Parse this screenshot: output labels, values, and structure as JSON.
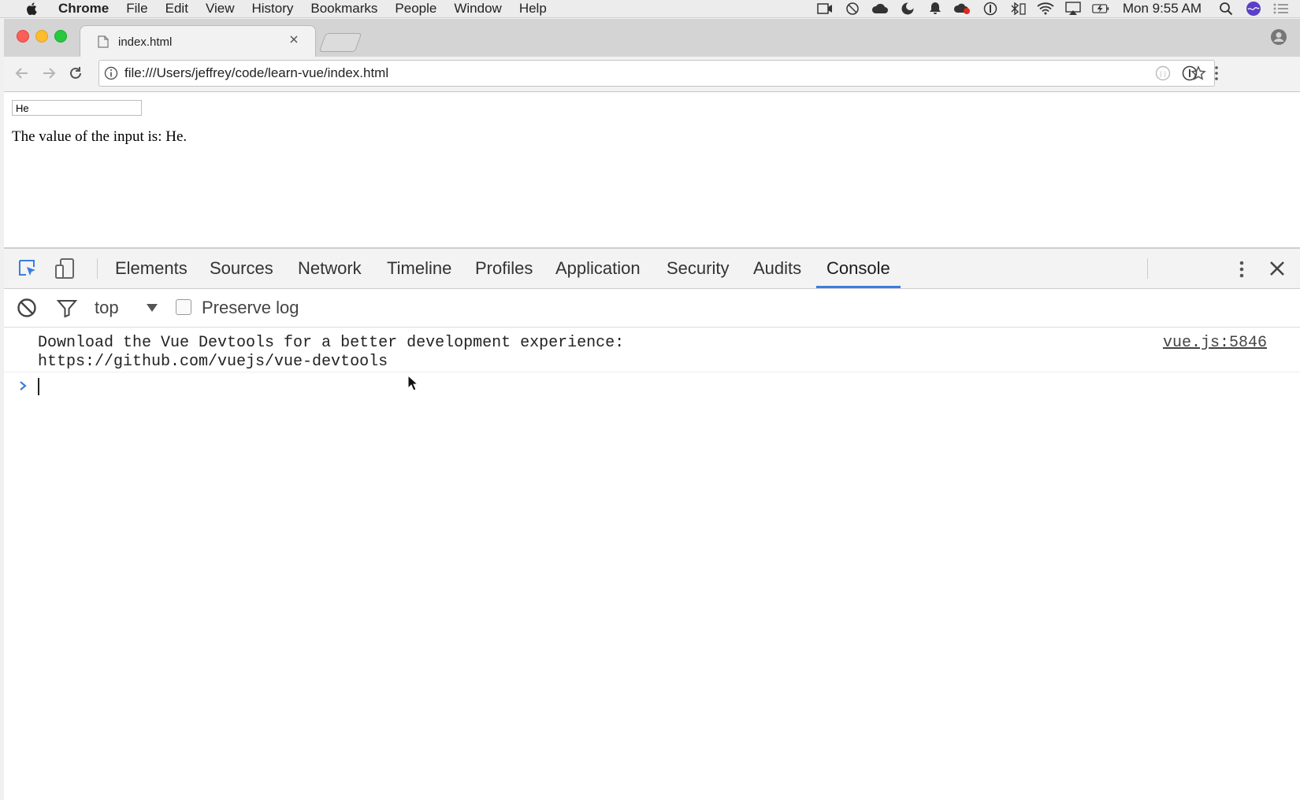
{
  "menubar": {
    "app_name": "Chrome",
    "items": [
      "File",
      "Edit",
      "View",
      "History",
      "Bookmarks",
      "People",
      "Window",
      "Help"
    ],
    "clock": "Mon 9:55 AM"
  },
  "browser": {
    "tab_title": "index.html",
    "url": "file:///Users/jeffrey/code/learn-vue/index.html"
  },
  "page": {
    "input_value": "He",
    "output_text": "The value of the input is: He."
  },
  "devtools": {
    "tabs": [
      "Elements",
      "Sources",
      "Network",
      "Timeline",
      "Profiles",
      "Application",
      "Security",
      "Audits",
      "Console"
    ],
    "active_tab": "Console",
    "accent_color": "#3b7ddd",
    "console_toolbar": {
      "context": "top",
      "preserve_log_label": "Preserve log",
      "preserve_log_checked": false
    },
    "messages": [
      {
        "line1": "Download the Vue Devtools for a better development experience:",
        "line2": "https://github.com/vuejs/vue-devtools",
        "source": "vue.js:5846"
      }
    ]
  }
}
